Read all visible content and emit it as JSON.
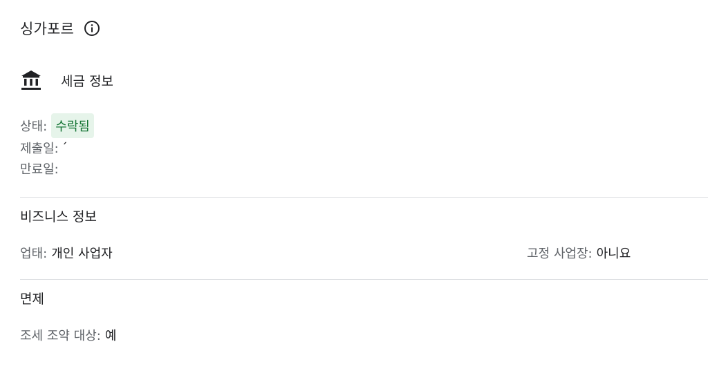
{
  "country": {
    "title": "싱가포르",
    "info_icon": "info-icon"
  },
  "tax": {
    "icon": "bank-icon",
    "title": "세금 정보",
    "status_label": "상태:",
    "status_value": "수락됨",
    "submitted_label": "제출일:",
    "submitted_value": "´",
    "expiry_label": "만료일:",
    "expiry_value": ""
  },
  "business": {
    "title": "비즈니스 정보",
    "type_label": "업태:",
    "type_value": "개인 사업자",
    "fixed_label": "고정 사업장:",
    "fixed_value": "아니요"
  },
  "exemption": {
    "title": "면제",
    "treaty_label": "조세 조약 대상:",
    "treaty_value": "예"
  },
  "colors": {
    "status_chip_bg": "#e6f4ea",
    "status_chip_text": "#137333",
    "label_text": "#5f6368",
    "value_text": "#202124",
    "divider": "#dadce0"
  }
}
